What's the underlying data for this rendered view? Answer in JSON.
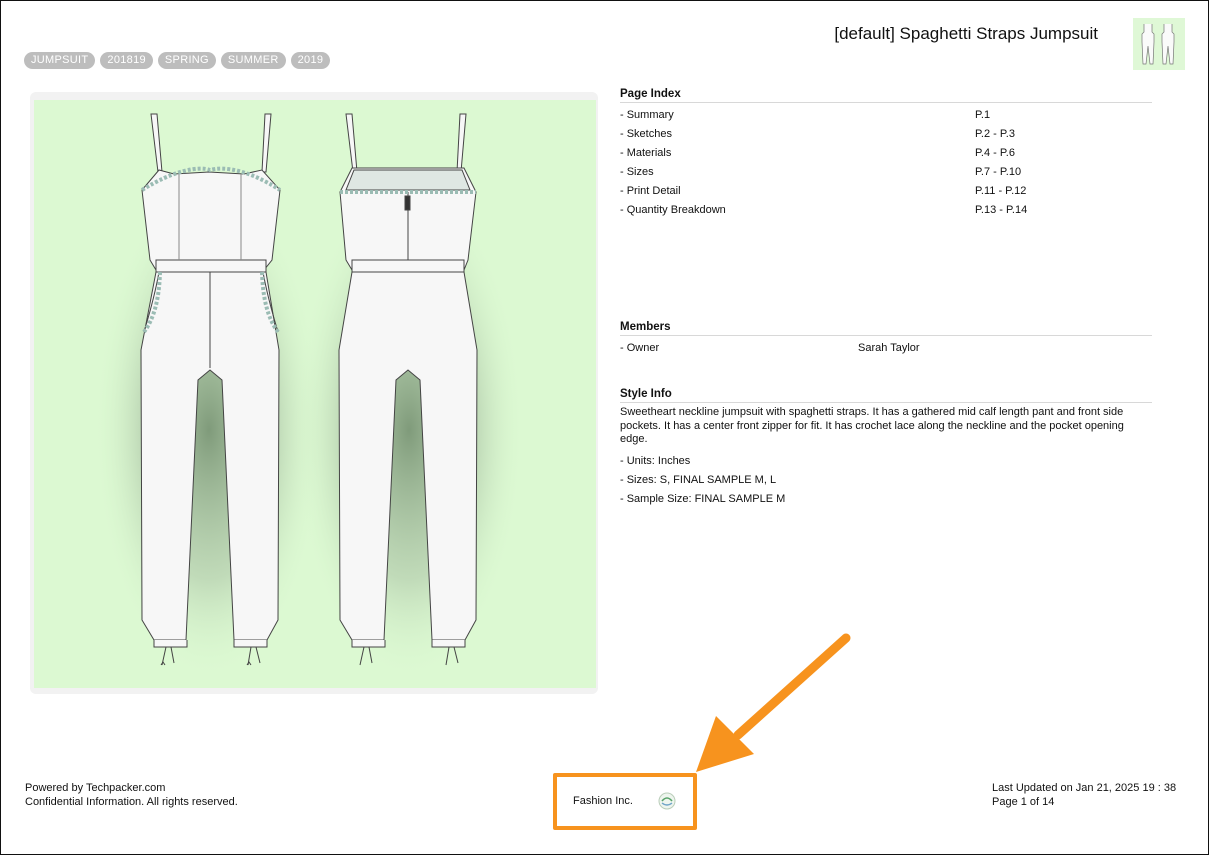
{
  "header": {
    "title": "[default] Spaghetti Straps Jumpsuit",
    "tags": [
      "JUMPSUIT",
      "201819",
      "SPRING",
      "SUMMER",
      "2019"
    ]
  },
  "page_index": {
    "heading": "Page Index",
    "items": [
      {
        "label": "- Summary",
        "pages": "P.1"
      },
      {
        "label": "- Sketches",
        "pages": "P.2 - P.3"
      },
      {
        "label": "- Materials",
        "pages": "P.4 - P.6"
      },
      {
        "label": "- Sizes",
        "pages": "P.7 - P.10"
      },
      {
        "label": "- Print Detail",
        "pages": "P.11 - P.12"
      },
      {
        "label": "- Quantity Breakdown",
        "pages": "P.13 - P.14"
      }
    ]
  },
  "members": {
    "heading": "Members",
    "items": [
      {
        "role": "- Owner",
        "name": "Sarah Taylor"
      }
    ]
  },
  "style_info": {
    "heading": "Style Info",
    "description": "Sweetheart neckline jumpsuit with spaghetti straps. It has a gathered mid calf length pant and front side pockets. It has a center front zipper for fit. It has crochet lace along the neckline and the pocket opening edge.",
    "units": "- Units: Inches",
    "sizes": "- Sizes: S, FINAL SAMPLE M, L",
    "sample_size": "- Sample Size: FINAL SAMPLE M"
  },
  "footer": {
    "powered_by": "Powered by Techpacker.com",
    "confidential": "Confidential Information. All rights reserved.",
    "company": "Fashion Inc.",
    "last_updated": "Last Updated on Jan 21, 2025 19 : 38",
    "page_number": "Page 1 of 14"
  },
  "colors": {
    "sketch_background": "#dcf9d2",
    "lace_trim": "#9bbcb4",
    "highlight": "#f7931e",
    "tag_background": "#bdbdbd"
  },
  "icons": {
    "thumbnail": "jumpsuit-thumbnail-icon",
    "company_logo": "company-logo-icon",
    "annotation_arrow": "arrow-icon"
  }
}
